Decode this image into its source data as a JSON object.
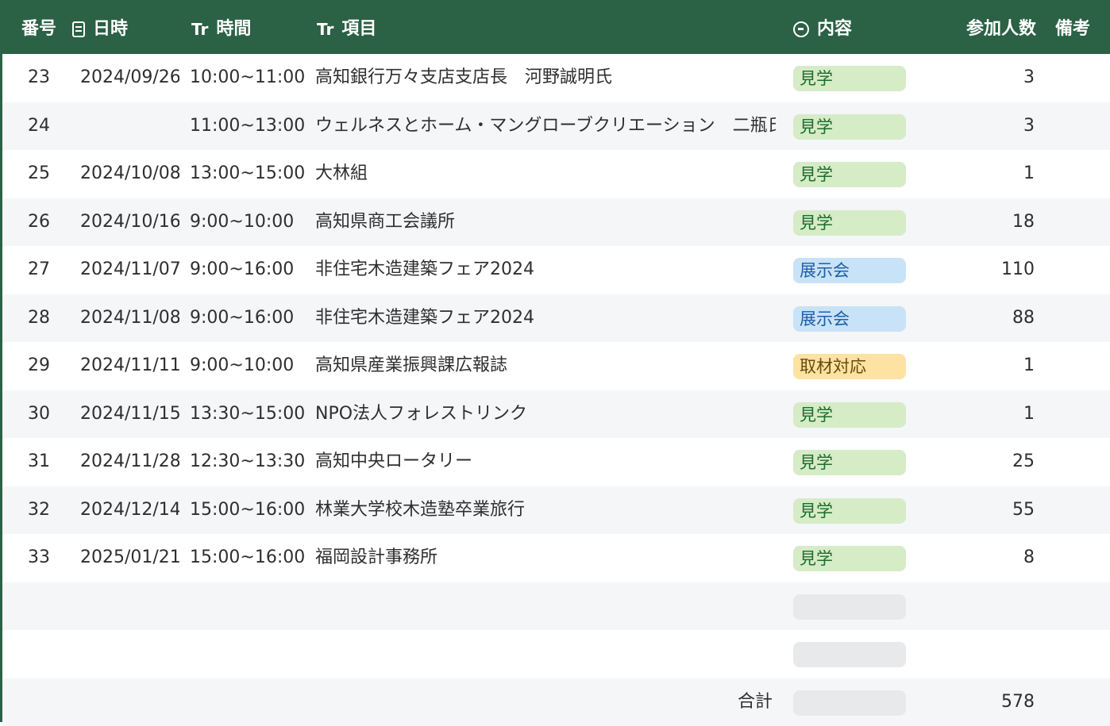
{
  "colors": {
    "header_bg": "#2b6145",
    "tag_green": "#d5ecc6",
    "tag_blue": "#c8e3f7",
    "tag_yellow": "#fde2a2",
    "tag_empty": "#e8e9eb"
  },
  "header": {
    "num": "番号",
    "date_icon": "calendar-icon",
    "date": "日時",
    "time_icon": "Tr",
    "time": "時間",
    "item_icon": "Tr",
    "item": "項目",
    "content_icon": "select-icon",
    "content": "内容",
    "count": "参加人数",
    "note": "備考"
  },
  "rows": [
    {
      "num": "23",
      "date": "2024/09/26",
      "time": "10:00~11:00",
      "item": "高知銀行万々支店支店長　河野誠明氏",
      "tag": "見学",
      "tag_color": "green",
      "count": "3",
      "note": ""
    },
    {
      "num": "24",
      "date": "",
      "time": "11:00~13:00",
      "item": "ウェルネスとホーム・マングローブクリエーション　二瓶氏",
      "tag": "見学",
      "tag_color": "green",
      "count": "3",
      "note": ""
    },
    {
      "num": "25",
      "date": "2024/10/08",
      "time": "13:00~15:00",
      "item": "大林組",
      "tag": "見学",
      "tag_color": "green",
      "count": "1",
      "note": ""
    },
    {
      "num": "26",
      "date": "2024/10/16",
      "time": "9:00~10:00",
      "item": "高知県商工会議所",
      "tag": "見学",
      "tag_color": "green",
      "count": "18",
      "note": ""
    },
    {
      "num": "27",
      "date": "2024/11/07",
      "time": "9:00~16:00",
      "item": "非住宅木造建築フェア2024",
      "tag": "展示会",
      "tag_color": "blue",
      "count": "110",
      "note": ""
    },
    {
      "num": "28",
      "date": "2024/11/08",
      "time": "9:00~16:00",
      "item": "非住宅木造建築フェア2024",
      "tag": "展示会",
      "tag_color": "blue",
      "count": "88",
      "note": ""
    },
    {
      "num": "29",
      "date": "2024/11/11",
      "time": "9:00~10:00",
      "item": "高知県産業振興課広報誌",
      "tag": "取材対応",
      "tag_color": "yellow",
      "count": "1",
      "note": ""
    },
    {
      "num": "30",
      "date": "2024/11/15",
      "time": "13:30~15:00",
      "item": "NPO法人フォレストリンク",
      "tag": "見学",
      "tag_color": "green",
      "count": "1",
      "note": ""
    },
    {
      "num": "31",
      "date": "2024/11/28",
      "time": "12:30~13:30",
      "item": "高知中央ロータリー",
      "tag": "見学",
      "tag_color": "green",
      "count": "25",
      "note": ""
    },
    {
      "num": "32",
      "date": "2024/12/14",
      "time": "15:00~16:00",
      "item": "林業大学校木造塾卒業旅行",
      "tag": "見学",
      "tag_color": "green",
      "count": "55",
      "note": ""
    },
    {
      "num": "33",
      "date": "2025/01/21",
      "time": "15:00~16:00",
      "item": "福岡設計事務所",
      "tag": "見学",
      "tag_color": "green",
      "count": "8",
      "note": ""
    },
    {
      "num": "",
      "date": "",
      "time": "",
      "item": "",
      "tag": "",
      "tag_color": "empty",
      "count": "",
      "note": ""
    },
    {
      "num": "",
      "date": "",
      "time": "",
      "item": "",
      "tag": "",
      "tag_color": "empty",
      "count": "",
      "note": ""
    }
  ],
  "total": {
    "label": "合計",
    "tag": "",
    "count": "578"
  }
}
